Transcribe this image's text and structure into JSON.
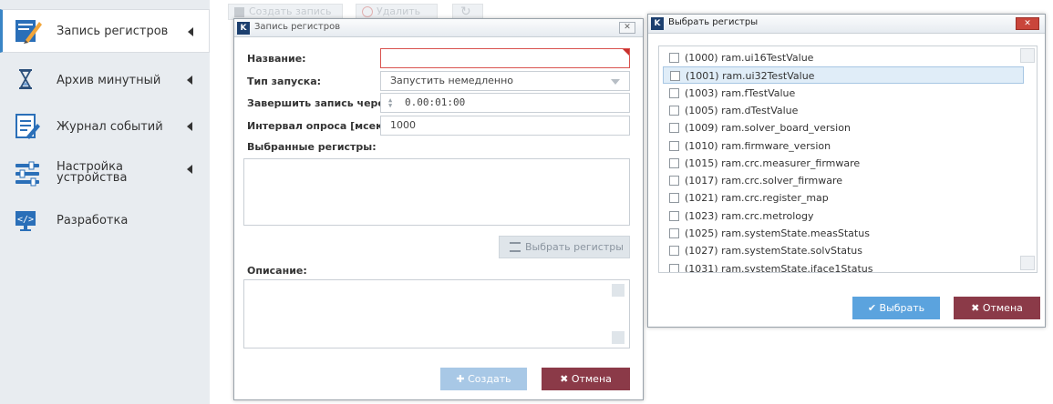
{
  "sidebar": {
    "items": [
      {
        "label": "Запись регистров",
        "icon": "pencil-paper-icon",
        "active": true
      },
      {
        "label": "Архив минутный",
        "icon": "hourglass-icon"
      },
      {
        "label": "Журнал событий",
        "icon": "journal-icon"
      },
      {
        "label": "Настройка\nустройства",
        "icon": "sliders-icon"
      },
      {
        "label": "Разработка",
        "icon": "code-monitor-icon"
      }
    ]
  },
  "toolbar": {
    "create_label": "Создать запись",
    "delete_label": "Удалить"
  },
  "record_dialog": {
    "title": "Запись регистров",
    "name_label": "Название:",
    "name_value": "",
    "launch_type_label": "Тип запуска:",
    "launch_type_value": "Запустить немедленно",
    "finish_label": "Завершить запись через:",
    "finish_value": "0.00:01:00",
    "interval_label": "Интервал опроса [мсек]:",
    "interval_value": "1000",
    "selected_registers_label": "Выбранные регистры:",
    "select_registers_button": "Выбрать регистры",
    "description_label": "Описание:",
    "create_button": "Создать",
    "cancel_button": "Отмена"
  },
  "select_dialog": {
    "title": "Выбрать регистры",
    "registers": [
      "(1000) ram.ui16TestValue",
      "(1001) ram.ui32TestValue",
      "(1003) ram.fTestValue",
      "(1005) ram.dTestValue",
      "(1009) ram.solver_board_version",
      "(1010) ram.firmware_version",
      "(1015) ram.crc.measurer_firmware",
      "(1017) ram.crc.solver_firmware",
      "(1021) ram.crc.register_map",
      "(1023) ram.crc.metrology",
      "(1025) ram.systemState.measStatus",
      "(1027) ram.systemState.solvStatus",
      "(1031) ram.systemState.iface1Status"
    ],
    "selected_index": 1,
    "select_button": "Выбрать",
    "cancel_button": "Отмена"
  },
  "colors": {
    "accent_blue": "#3a85c6",
    "cancel_red": "#8b3a48",
    "close_red": "#c9453b"
  }
}
